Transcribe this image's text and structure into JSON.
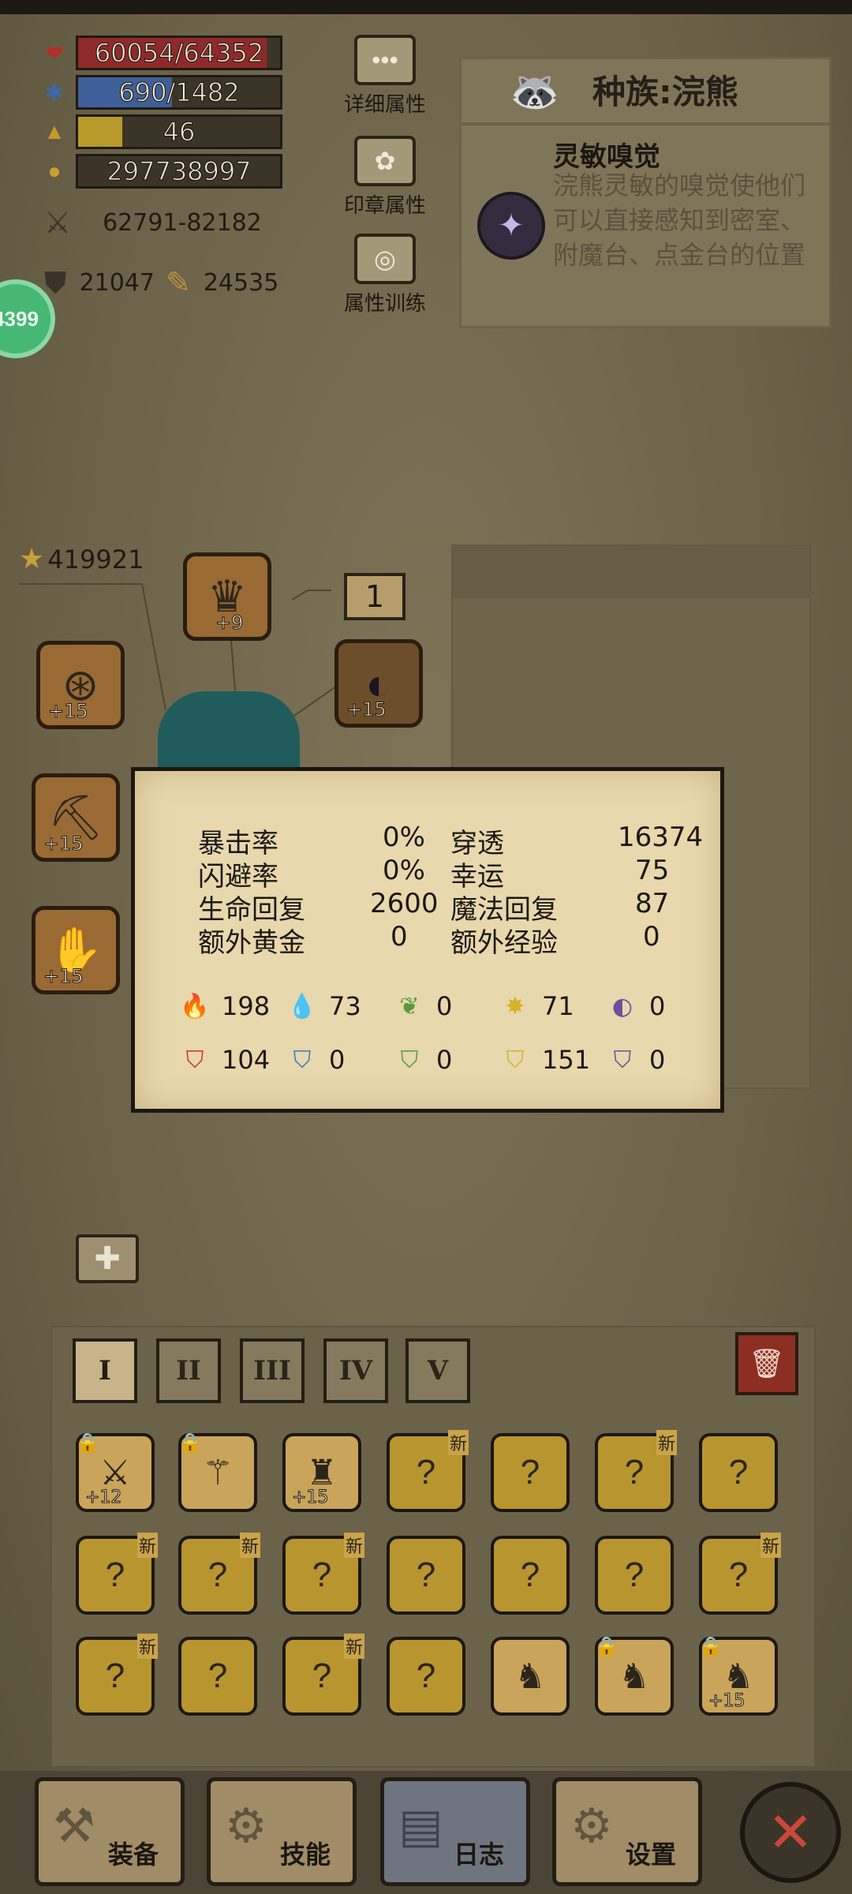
{
  "stats": {
    "hp": "60054/64352",
    "mp": "690/1482",
    "level": "46",
    "gold": "297738997",
    "attack": "62791-82182",
    "defense": "21047",
    "magic": "24535",
    "hp_fill": 0.933,
    "mp_fill": 0.465,
    "exp_fill": 0.22,
    "colors": {
      "hp": "#8f2a2a",
      "mp": "#3f5f99",
      "exp": "#b89a2a"
    }
  },
  "attr_buttons": [
    {
      "label": "详细属性",
      "icon": "dots-icon"
    },
    {
      "label": "印章属性",
      "icon": "flower-icon"
    },
    {
      "label": "属性训练",
      "icon": "target-icon"
    }
  ],
  "race": {
    "title": "种族:浣熊",
    "skill_name": "灵敏嗅觉",
    "skill_desc": "浣熊灵敏的嗅觉使他们可以直接感知到密室、附魔台、点金台的位置"
  },
  "side_badge": "4399",
  "equipment": {
    "power": "419921",
    "counter": "1",
    "slots": [
      {
        "name": "helmet",
        "plus": "+9"
      },
      {
        "name": "bracer",
        "plus": "+15"
      },
      {
        "name": "shield",
        "plus": "+15"
      },
      {
        "name": "drill",
        "plus": "+15"
      },
      {
        "name": "gauntlet",
        "plus": "+15"
      }
    ]
  },
  "tooltip": {
    "rows": [
      {
        "l_label": "暴击率",
        "l_val": "0%",
        "r_label": "穿透",
        "r_val": "16374"
      },
      {
        "l_label": "闪避率",
        "l_val": "0%",
        "r_label": "幸运",
        "r_val": "75"
      },
      {
        "l_label": "生命回复",
        "l_val": "2600",
        "r_label": "魔法回复",
        "r_val": "87"
      },
      {
        "l_label": "额外黄金",
        "l_val": "0",
        "r_label": "额外经验",
        "r_val": "0"
      }
    ],
    "elements_attack": [
      "198",
      "73",
      "0",
      "71",
      "0"
    ],
    "elements_defense": [
      "104",
      "0",
      "0",
      "151",
      "0"
    ],
    "element_colors": [
      "#c8352a",
      "#3b7bbd",
      "#5a9a3a",
      "#d8b32a",
      "#6b4fa0"
    ]
  },
  "bag": {
    "tabs": [
      "I",
      "II",
      "III",
      "IV",
      "V"
    ],
    "new_label": "新",
    "items_row1": [
      {
        "plus": "+12"
      },
      {
        "plus": ""
      },
      {
        "plus": "+15"
      },
      {
        "plus": ""
      },
      {
        "plus": ""
      },
      {
        "plus": ""
      },
      {
        "plus": ""
      }
    ],
    "plus_last": "+15"
  },
  "nav": {
    "equip": "装备",
    "skill": "技能",
    "log": "日志",
    "settings": "设置"
  }
}
